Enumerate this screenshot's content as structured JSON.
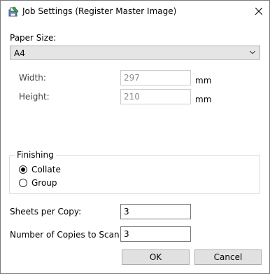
{
  "window": {
    "title": "Job Settings (Register Master Image)",
    "icon": "job-settings-icon",
    "close_icon": "close-icon"
  },
  "paper_size": {
    "label": "Paper Size:",
    "selected": "A4",
    "dropdown_icon": "chevron-down-icon"
  },
  "dimensions": {
    "width_label": "Width:",
    "width_value": "297",
    "width_unit": "mm",
    "height_label": "Height:",
    "height_value": "210",
    "height_unit": "mm"
  },
  "finishing": {
    "legend": "Finishing",
    "options": [
      {
        "label": "Collate",
        "checked": true
      },
      {
        "label": "Group",
        "checked": false
      }
    ]
  },
  "sheets_per_copy": {
    "label": "Sheets per Copy:",
    "value": "3"
  },
  "copies_to_scan": {
    "label": "Number of Copies to Scan:",
    "value": "3"
  },
  "buttons": {
    "ok": "OK",
    "cancel": "Cancel"
  }
}
